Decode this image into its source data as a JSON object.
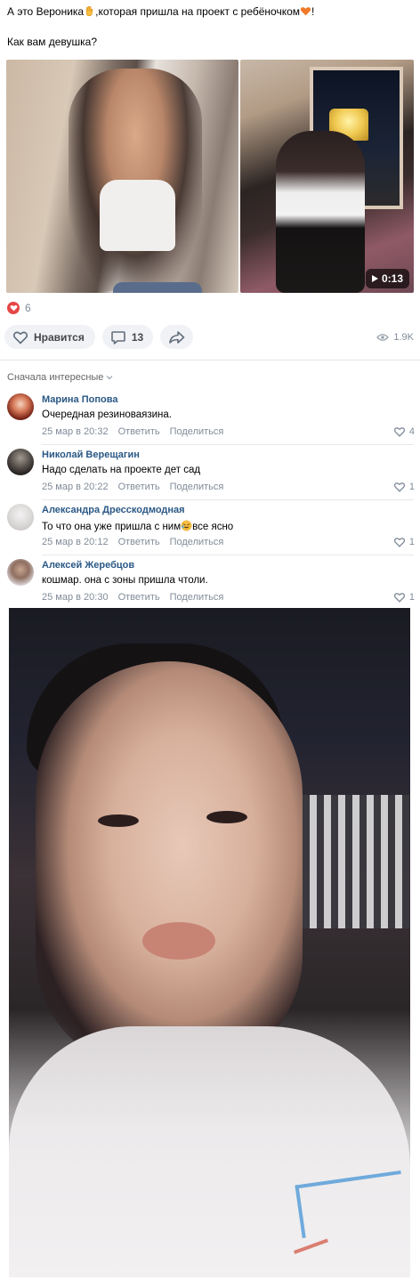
{
  "post": {
    "line1_before": "А это Вероника",
    "line1_middle": ",которая пришла на проект с ребёночком",
    "line1_after": "!",
    "line2": "Как вам девушка?"
  },
  "media": {
    "video_duration": "0:13"
  },
  "reactions": {
    "likes_count": "6"
  },
  "actions": {
    "like_label": "Нравится",
    "comments_count": "13",
    "views": "1.9K"
  },
  "comments_header": {
    "sort_label": "Сначала интересные"
  },
  "comments": [
    {
      "name": "Марина Попова",
      "text": "Очередная резиноваязина.",
      "date": "25 мар в 20:32",
      "reply": "Ответить",
      "share": "Поделиться",
      "likes": "4"
    },
    {
      "name": "Николай Верещагин",
      "text": "Надо сделать на проекте дет сад",
      "date": "25 мар в 20:22",
      "reply": "Ответить",
      "share": "Поделиться",
      "likes": "1"
    },
    {
      "name": "Александра Дресскодмодная",
      "text_before": "То что она уже пришла с ним",
      "text_after": "все ясно",
      "date": "25 мар в 20:12",
      "reply": "Ответить",
      "share": "Поделиться",
      "likes": "1"
    },
    {
      "name": "Алексей Жеребцов",
      "text": "кошмар. она с зоны пришла чтоли.",
      "date": "25 мар в 20:30",
      "reply": "Ответить",
      "share": "Поделиться",
      "likes": "1"
    }
  ],
  "colors": {
    "link": "#2a5885",
    "meta": "#818c99",
    "like_red": "#e64646",
    "pill_bg": "#f0f2f5"
  }
}
